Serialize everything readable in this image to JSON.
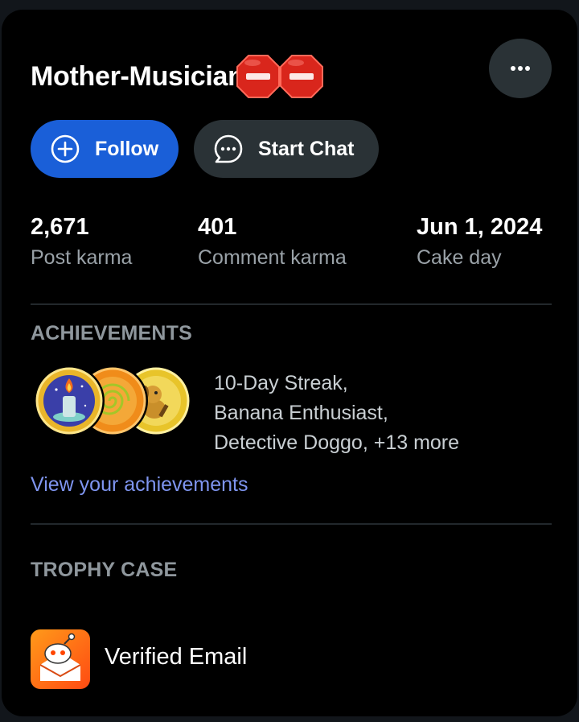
{
  "profile": {
    "username": "Mother-Musician",
    "username_emojis": [
      "stop-sign-icon",
      "stop-sign-icon"
    ],
    "more_icon": "ellipsis-icon"
  },
  "actions": {
    "follow_label": "Follow",
    "follow_icon": "plus-circle-icon",
    "chat_label": "Start Chat",
    "chat_icon": "chat-bubble-icon"
  },
  "stats": [
    {
      "value": "2,671",
      "label": "Post karma"
    },
    {
      "value": "401",
      "label": "Comment karma"
    },
    {
      "value": "Jun 1, 2024",
      "label": "Cake day"
    }
  ],
  "achievements": {
    "title": "ACHIEVEMENTS",
    "badges": [
      "candle-badge-icon",
      "banana-spiral-badge-icon",
      "detective-doggo-badge-icon"
    ],
    "line1": "10-Day Streak,",
    "line2": "Banana Enthusiast,",
    "line3": "Detective Doggo, +13 more",
    "link_label": "View your achievements"
  },
  "trophies": {
    "title": "TROPHY CASE",
    "items": [
      {
        "label": "Verified Email",
        "icon": "verified-email-trophy-icon"
      }
    ]
  },
  "colors": {
    "background": "#000000",
    "follow_button": "#1a5fd8",
    "secondary_button": "#2a3236",
    "link": "#7f95f0",
    "muted_text": "#9aa2a8",
    "stop_sign": "#d9261c"
  }
}
